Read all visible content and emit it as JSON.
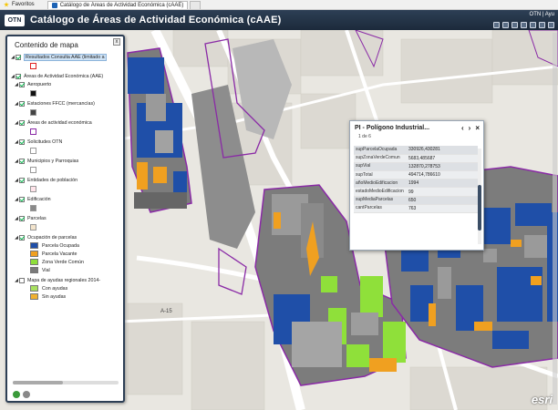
{
  "browser": {
    "favorites_label": "Favoritos",
    "tab_label": "Catálogo de Áreas de Actividad Económica (cAAE)"
  },
  "app": {
    "logo": "OTN",
    "title": "Catálogo de Áreas de Actividad Económica (cAAE)",
    "top_right": "OTN | Ayu"
  },
  "toc": {
    "title": "Contenido de mapa",
    "close_label": "x",
    "layers": [
      {
        "label": "Resultados Consulta AAE (limitado a",
        "checked": true,
        "highlight": true,
        "swatch": "#ffffff",
        "swatch_border": "#e02020"
      },
      {
        "label": "Áreas de Actividad Económica (AAE)",
        "checked": true
      },
      {
        "label": "Aeropuerto",
        "checked": true,
        "swatch": "#111111"
      },
      {
        "label": "Estaciones FFCC (mercancías)",
        "checked": true,
        "swatch": "#444444"
      },
      {
        "label": "Áreas de actividad económica",
        "checked": true,
        "swatch": "#ffffff",
        "swatch_border": "#8a2aa6"
      },
      {
        "label": "Solicitudes OTN",
        "checked": true,
        "swatch": "#ffffff"
      },
      {
        "label": "Municipios y Parroquias",
        "checked": true,
        "swatch": "#ffffff"
      },
      {
        "label": "Entidades de población",
        "checked": true,
        "swatch": "#ffe4ea"
      },
      {
        "label": "Edificación",
        "checked": true,
        "swatch": "#8a8a8a"
      },
      {
        "label": "Parcelas",
        "checked": true,
        "swatch": "#f3e4cc"
      },
      {
        "label": "Ocupación de parcelas",
        "checked": true
      }
    ],
    "ocupacion_items": [
      {
        "label": "Parcela Ocupada",
        "color": "#1f4fa8"
      },
      {
        "label": "Parcela Vacante",
        "color": "#f0a020"
      },
      {
        "label": "Zona Verde Común",
        "color": "#8fe03a"
      },
      {
        "label": "Vial",
        "color": "#7a7a7a"
      }
    ],
    "ayudas_label": "Mapa de ayudas regionales 2014-",
    "ayudas_items": [
      {
        "label": "Con ayudas",
        "color": "#a8e060"
      },
      {
        "label": "Sin ayudas",
        "color": "#f0b030"
      }
    ]
  },
  "popup": {
    "title": "PI - Polígono Industrial...",
    "prev_label": "‹",
    "next_label": "›",
    "close_label": "×",
    "count": "1 de 6",
    "rows": [
      {
        "key": "supParcelaOcupada",
        "value": "330926,430281"
      },
      {
        "key": "supZonaVerdeComun",
        "value": "5683,485687"
      },
      {
        "key": "supVial",
        "value": "132870,278753"
      },
      {
        "key": "supTotal",
        "value": "494714,786610"
      },
      {
        "key": "añoMedioEdificacion",
        "value": "1994"
      },
      {
        "key": "estadoMedioEdificacion",
        "value": "99"
      },
      {
        "key": "supMediaParcelas",
        "value": "650"
      },
      {
        "key": "cantParcelas",
        "value": "763"
      }
    ]
  },
  "map": {
    "road_label": "A-15",
    "attribution": "esri"
  }
}
